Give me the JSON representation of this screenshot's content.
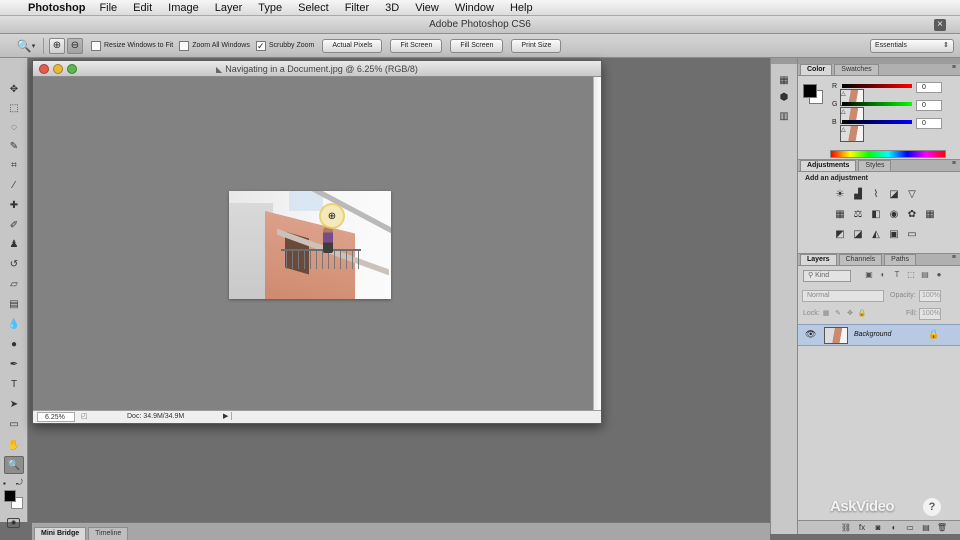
{
  "menubar": {
    "app_name": "Photoshop",
    "items": [
      "File",
      "Edit",
      "Image",
      "Layer",
      "Type",
      "Select",
      "Filter",
      "3D",
      "View",
      "Window",
      "Help"
    ]
  },
  "titlebar": {
    "title": "Adobe Photoshop CS6"
  },
  "options": {
    "resize_windows": "Resize Windows to Fit",
    "zoom_all": "Zoom All Windows",
    "scrubby_zoom": "Scrubby Zoom",
    "buttons": [
      "Actual Pixels",
      "Fit Screen",
      "Fill Screen",
      "Print Size"
    ],
    "workspace": "Essentials",
    "checked": {
      "resize_windows": false,
      "zoom_all": false,
      "scrubby_zoom": true
    }
  },
  "document": {
    "title": "Navigating in a Document.jpg @ 6.25% (RGB/8)",
    "zoom": "6.25%",
    "doc_info": "Doc: 34.9M/34.9M"
  },
  "color_panel": {
    "tabs": [
      "Color",
      "Swatches"
    ],
    "r_label": "R",
    "g_label": "G",
    "b_label": "B",
    "r": "0",
    "g": "0",
    "b": "0"
  },
  "adjustments_panel": {
    "tabs": [
      "Adjustments",
      "Styles"
    ],
    "heading": "Add an adjustment"
  },
  "layers_panel": {
    "tabs": [
      "Layers",
      "Channels",
      "Paths"
    ],
    "filter": "Kind",
    "blend_mode": "Normal",
    "opacity_label": "Opacity:",
    "opacity_value": "100%",
    "lock_label": "Lock:",
    "fill_label": "Fill:",
    "fill_value": "100%",
    "layers": [
      {
        "name": "Background"
      }
    ]
  },
  "bottom_tabs": [
    "Mini Bridge",
    "Timeline"
  ],
  "watermark": {
    "text": "AskVideo"
  },
  "colors": {
    "workspace_gray": "#6e6e6e",
    "canvas_gray": "#828282",
    "layer_selection": "#b8c9e3"
  }
}
